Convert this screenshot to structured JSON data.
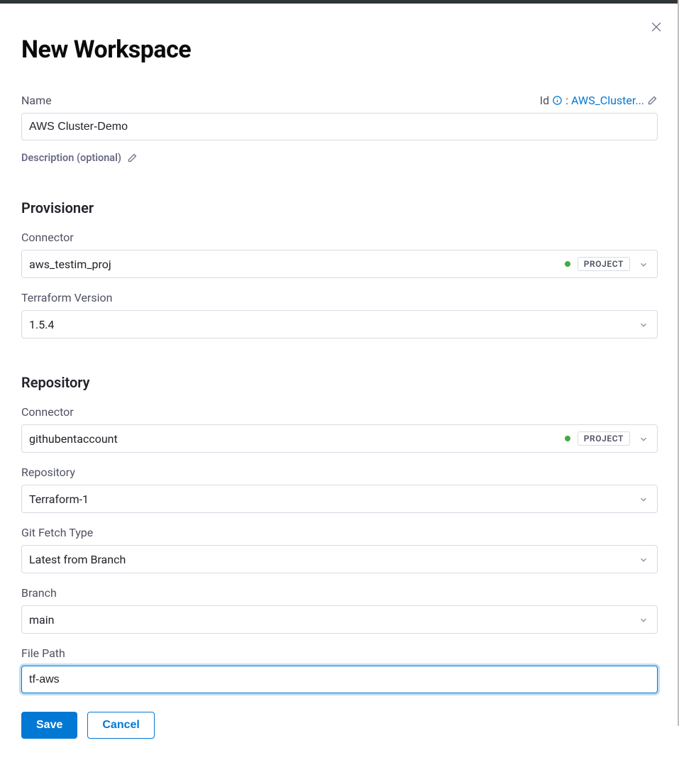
{
  "header": {
    "title": "New Workspace"
  },
  "name": {
    "label": "Name",
    "value": "AWS Cluster-Demo",
    "id_label": "Id",
    "id_value": "AWS_Cluster..."
  },
  "description": {
    "label": "Description (optional)"
  },
  "sections": {
    "provisioner": {
      "heading": "Provisioner",
      "connector_label": "Connector",
      "connector_value": "aws_testim_proj",
      "connector_scope": "PROJECT",
      "tf_version_label": "Terraform Version",
      "tf_version_value": "1.5.4"
    },
    "repository": {
      "heading": "Repository",
      "connector_label": "Connector",
      "connector_value": "githubentaccount",
      "connector_scope": "PROJECT",
      "repo_label": "Repository",
      "repo_value": "Terraform-1",
      "fetch_type_label": "Git Fetch Type",
      "fetch_type_value": "Latest from Branch",
      "branch_label": "Branch",
      "branch_value": "main",
      "filepath_label": "File Path",
      "filepath_value": "tf-aws"
    }
  },
  "footer": {
    "save": "Save",
    "cancel": "Cancel"
  }
}
